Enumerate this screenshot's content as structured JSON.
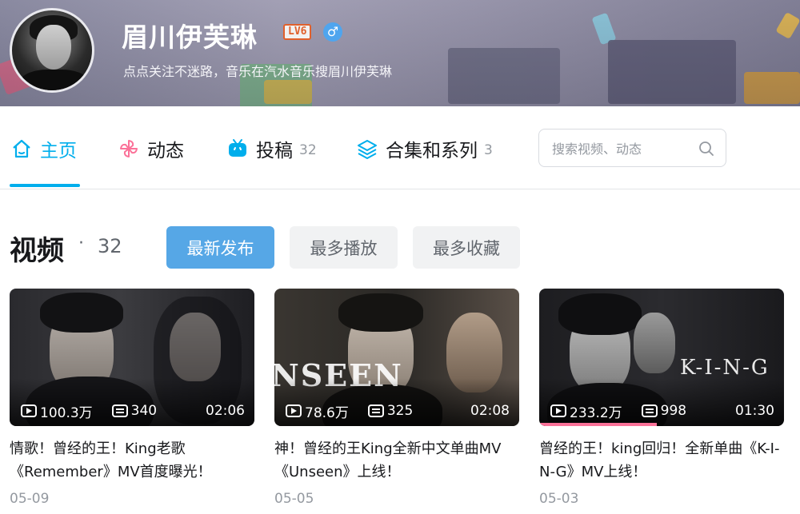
{
  "profile": {
    "name": "眉川伊芙琳",
    "level_badge": "LV6",
    "gender_symbol": "♂",
    "signature": "点点关注不迷路，音乐在汽水音乐搜眉川伊芙琳"
  },
  "nav": {
    "tabs": [
      {
        "label": "主页",
        "count": "",
        "icon": "home-icon",
        "active": true
      },
      {
        "label": "动态",
        "count": "",
        "icon": "pinwheel-icon",
        "active": false
      },
      {
        "label": "投稿",
        "count": "32",
        "icon": "tv-icon",
        "active": false
      },
      {
        "label": "合集和系列",
        "count": "3",
        "icon": "layers-icon",
        "active": false
      }
    ],
    "search_placeholder": "搜索视频、动态"
  },
  "section": {
    "title": "视频",
    "dot": "·",
    "count": "32",
    "sort_buttons": [
      {
        "label": "最新发布",
        "active": true
      },
      {
        "label": "最多播放",
        "active": false
      },
      {
        "label": "最多收藏",
        "active": false
      }
    ]
  },
  "videos": [
    {
      "plays": "100.3万",
      "danmaku": "340",
      "duration": "02:06",
      "title": "情歌！曾经的王！King老歌《Remember》MV首度曝光！",
      "date": "05-09",
      "watch_progress": 0
    },
    {
      "plays": "78.6万",
      "danmaku": "325",
      "duration": "02:08",
      "title": "神！曾经的王King全新中文单曲MV《Unseen》上线！",
      "date": "05-05",
      "watch_progress": 0,
      "watermark": "NSEEN"
    },
    {
      "plays": "233.2万",
      "danmaku": "998",
      "duration": "01:30",
      "title": "曾经的王！king回归！全新单曲《K-I-N-G》MV上线！",
      "date": "05-03",
      "watch_progress": 0.48,
      "watermark": "K-I-N-G"
    }
  ],
  "colors": {
    "accent": "#00aeec",
    "sort_active": "#56a7e6",
    "progress": "#fb7299",
    "level": "#e0602c"
  }
}
